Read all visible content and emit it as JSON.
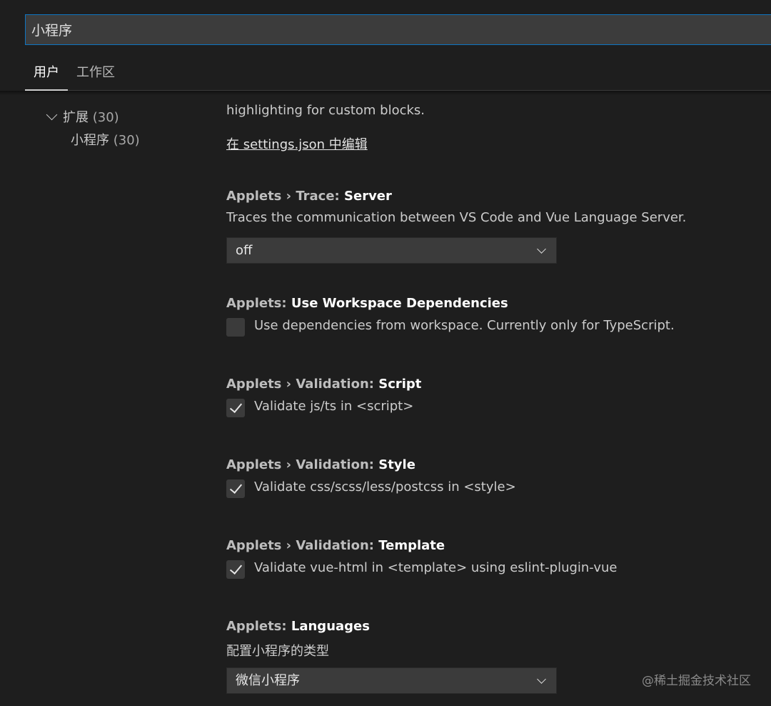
{
  "search": {
    "value": "小程序"
  },
  "tabs": [
    {
      "label": "用户",
      "active": true
    },
    {
      "label": "工作区",
      "active": false
    }
  ],
  "tree": {
    "group": {
      "label": "扩展",
      "count": "(30)"
    },
    "child": {
      "label": "小程序",
      "count": "(30)"
    }
  },
  "content": {
    "truncated_desc": "highlighting for custom blocks.",
    "edit_link": "在 settings.json 中编辑",
    "settings": [
      {
        "prefix": "Applets › Trace: ",
        "name": "Server",
        "description": "Traces the communication between VS Code and Vue Language Server.",
        "select_value": "off"
      },
      {
        "prefix": "Applets: ",
        "name": "Use Workspace Dependencies",
        "checkbox_label": "Use dependencies from workspace. Currently only for TypeScript.",
        "checked": false
      },
      {
        "prefix": "Applets › Validation: ",
        "name": "Script",
        "checkbox_label": "Validate js/ts in <script>",
        "checked": true
      },
      {
        "prefix": "Applets › Validation: ",
        "name": "Style",
        "checkbox_label": "Validate css/scss/less/postcss in <style>",
        "checked": true
      },
      {
        "prefix": "Applets › Validation: ",
        "name": "Template",
        "checkbox_label": "Validate vue-html in <template> using eslint-plugin-vue",
        "checked": true
      },
      {
        "prefix": "Applets: ",
        "name": "Languages",
        "description": "配置小程序的类型",
        "select_value": "微信小程序"
      }
    ]
  },
  "watermark": "@稀土掘金技术社区",
  "colors": {
    "background": "#1e1e1e",
    "input_border": "#0e75c2",
    "control_bg": "#3b3b3b"
  }
}
